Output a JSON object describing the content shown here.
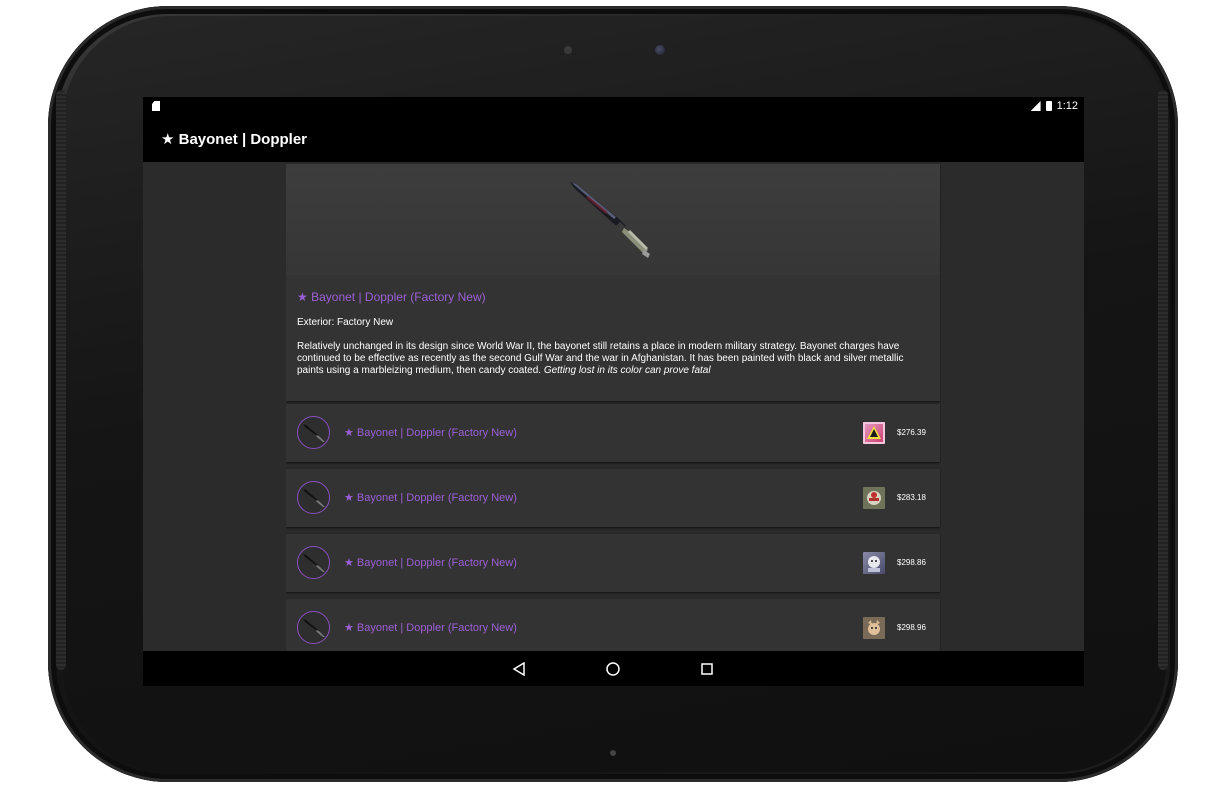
{
  "status_bar": {
    "network": "3G",
    "time": "1:12"
  },
  "action_bar": {
    "title": "★ Bayonet | Doppler"
  },
  "detail": {
    "title": "★ Bayonet | Doppler (Factory New)",
    "exterior": "Exterior: Factory New",
    "description": "Relatively unchanged in its design since World War II, the bayonet still retains a place in modern military strategy. Bayonet charges have continued to be effective as recently as the second Gulf War and the war in Afghanistan. It has been painted with black and silver metallic paints using a marbleizing medium, then candy coated.",
    "flavor_text": "Getting lost in its color can prove fatal"
  },
  "listings": [
    {
      "name": "★ Bayonet | Doppler (Factory New)",
      "price": "$276.39",
      "seller_icon": "pink-sticker-icon"
    },
    {
      "name": "★ Bayonet | Doppler (Factory New)",
      "price": "$283.18",
      "seller_icon": "badge-icon"
    },
    {
      "name": "★ Bayonet | Doppler (Factory New)",
      "price": "$298.86",
      "seller_icon": "character-icon"
    },
    {
      "name": "★ Bayonet | Doppler (Factory New)",
      "price": "$298.96",
      "seller_icon": "cat-icon"
    }
  ],
  "navigation": {
    "back": "back-icon",
    "home": "home-icon",
    "recents": "recents-icon"
  },
  "colors": {
    "accent": "#9b5fd6",
    "background": "#2b2b2b",
    "card": "#333333",
    "bars": "#000000"
  }
}
